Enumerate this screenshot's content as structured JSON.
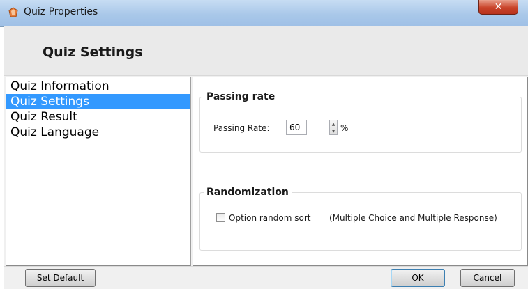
{
  "window": {
    "title": "Quiz Properties",
    "close_glyph": "✕"
  },
  "header": {
    "title": "Quiz Settings"
  },
  "nav": {
    "items": [
      {
        "label": "Quiz Information"
      },
      {
        "label": "Quiz Settings",
        "selected": true
      },
      {
        "label": "Quiz Result"
      },
      {
        "label": "Quiz Language"
      }
    ]
  },
  "passing": {
    "group_title": "Passing rate",
    "field_label": "Passing Rate:",
    "value": "60",
    "unit": "%"
  },
  "randomization": {
    "group_title": "Randomization",
    "checkbox_label": "Option random sort",
    "checkbox_checked": false,
    "note": "(Multiple Choice and Multiple Response)"
  },
  "footer": {
    "set_default": "Set Default",
    "ok": "OK",
    "cancel": "Cancel"
  },
  "icons": {
    "app": "quiz-app-icon",
    "spin_up": "▲",
    "spin_down": "▼"
  },
  "colors": {
    "selection": "#3399ff",
    "titlebar": "#a9c8e9",
    "close": "#c9442a"
  }
}
